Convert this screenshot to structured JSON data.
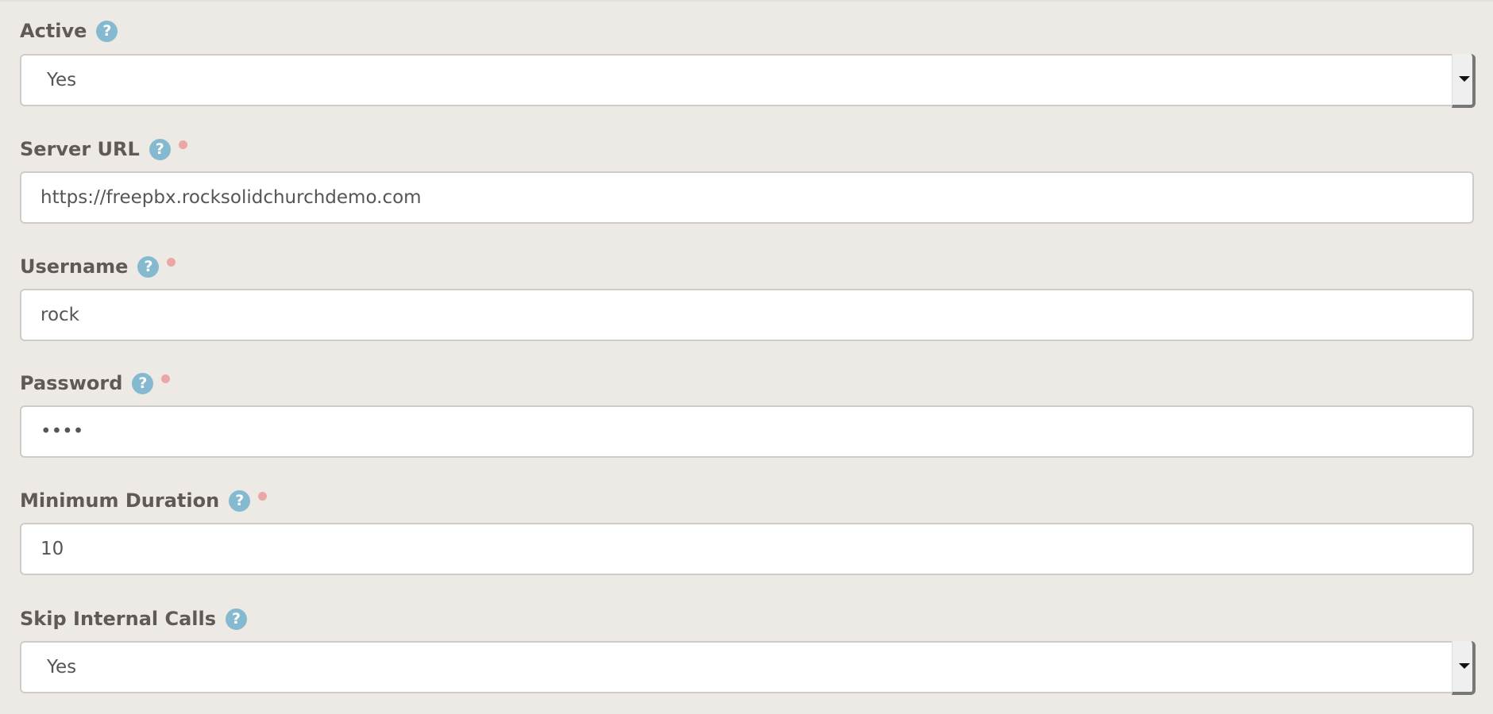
{
  "fields": [
    {
      "label": "Active",
      "type": "select",
      "value": "Yes",
      "required": false
    },
    {
      "label": "Server URL",
      "type": "text",
      "value": "https://freepbx.rocksolidchurchdemo.com",
      "required": true
    },
    {
      "label": "Username",
      "type": "text",
      "value": "rock",
      "required": true
    },
    {
      "label": "Password",
      "type": "password",
      "value": "••••",
      "required": true
    },
    {
      "label": "Minimum Duration",
      "type": "text",
      "value": "10",
      "required": true
    },
    {
      "label": "Skip Internal Calls",
      "type": "select",
      "value": "Yes",
      "required": false
    }
  ],
  "help_icon": "?",
  "colors": {
    "help": "#85b9cf",
    "required": "#eba6a6",
    "background": "#edeae6"
  }
}
